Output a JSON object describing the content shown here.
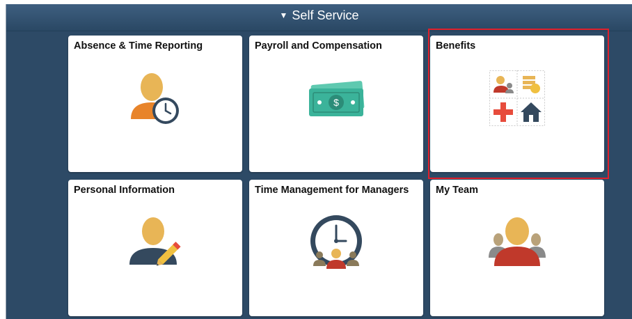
{
  "header": {
    "title": "Self Service",
    "caret_icon": "caret-down-icon"
  },
  "tiles": [
    {
      "title": "Absence & Time Reporting",
      "icon": "person-clock-icon"
    },
    {
      "title": "Payroll and Compensation",
      "icon": "money-icon"
    },
    {
      "title": "Benefits",
      "icon": "benefits-icon",
      "highlighted": true
    },
    {
      "title": "Personal Information",
      "icon": "person-pencil-icon"
    },
    {
      "title": "Time Management for Managers",
      "icon": "team-clock-icon"
    },
    {
      "title": "My Team",
      "icon": "team-icon"
    }
  ],
  "colors": {
    "background": "#2d4a66",
    "highlight": "#e0202b",
    "person": "#e8b556",
    "orange": "#e8842a",
    "navy": "#34495e",
    "green": "#3bb39a",
    "red": "#c0392b"
  }
}
